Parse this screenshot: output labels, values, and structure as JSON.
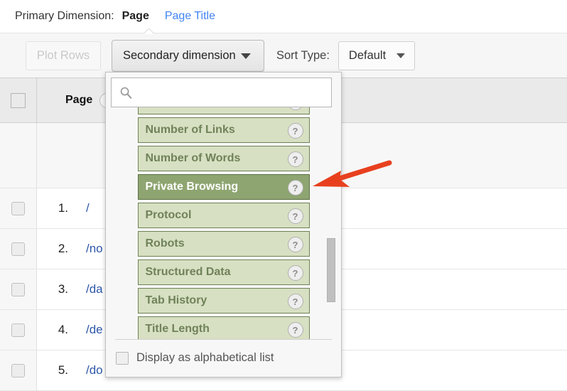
{
  "primary": {
    "label": "Primary Dimension:",
    "active": "Page",
    "link": "Page Title"
  },
  "toolbar": {
    "plot_rows_label": "Plot Rows",
    "secondary_dimension_label": "Secondary dimension",
    "sort_type_label": "Sort Type:",
    "sort_value": "Default",
    "caret_icon": "chevron-down-icon"
  },
  "table": {
    "header_checkbox_icon": "checkbox-unchecked-icon",
    "columns": [
      "Page"
    ],
    "help_icon": "help-circle-icon",
    "rows": [
      {
        "index": "1.",
        "page": "/"
      },
      {
        "index": "2.",
        "page": "/no"
      },
      {
        "index": "3.",
        "page": "/da"
      },
      {
        "index": "4.",
        "page": "/de"
      },
      {
        "index": "5.",
        "page": "/do"
      }
    ]
  },
  "dropdown": {
    "search": {
      "value": "",
      "placeholder": "",
      "icon": "search-icon"
    },
    "items": [
      {
        "label": "",
        "selected": false,
        "partial": true,
        "help_icon": "help-circle-icon"
      },
      {
        "label": "Number of Links",
        "selected": false,
        "help_icon": "help-circle-icon"
      },
      {
        "label": "Number of Words",
        "selected": false,
        "help_icon": "help-circle-icon"
      },
      {
        "label": "Private Browsing",
        "selected": true,
        "help_icon": "help-circle-icon"
      },
      {
        "label": "Protocol",
        "selected": false,
        "help_icon": "help-circle-icon"
      },
      {
        "label": "Robots",
        "selected": false,
        "help_icon": "help-circle-icon"
      },
      {
        "label": "Structured Data",
        "selected": false,
        "help_icon": "help-circle-icon"
      },
      {
        "label": "Tab History",
        "selected": false,
        "help_icon": "help-circle-icon"
      },
      {
        "label": "Title Length",
        "selected": false,
        "help_icon": "help-circle-icon"
      }
    ],
    "help_glyph": "?",
    "footer": {
      "checkbox_icon": "checkbox-unchecked-icon",
      "label": "Display as alphabetical list",
      "checked": false
    },
    "scrollbar": {
      "icon": "scrollbar-thumb"
    }
  },
  "annotation": {
    "arrow_icon": "arrow-pointer-left",
    "color": "#e8401f"
  },
  "colors": {
    "item_fill": "#d7e0c2",
    "item_border": "#6f8257",
    "item_text": "#70825a",
    "item_selected_fill": "#8ea571",
    "item_selected_text": "#ffffff",
    "link_blue": "#4184f3",
    "row_link_blue": "#2d56a8",
    "toolbar_bg": "#f6f6f6",
    "header_bg": "#eaeaea"
  }
}
